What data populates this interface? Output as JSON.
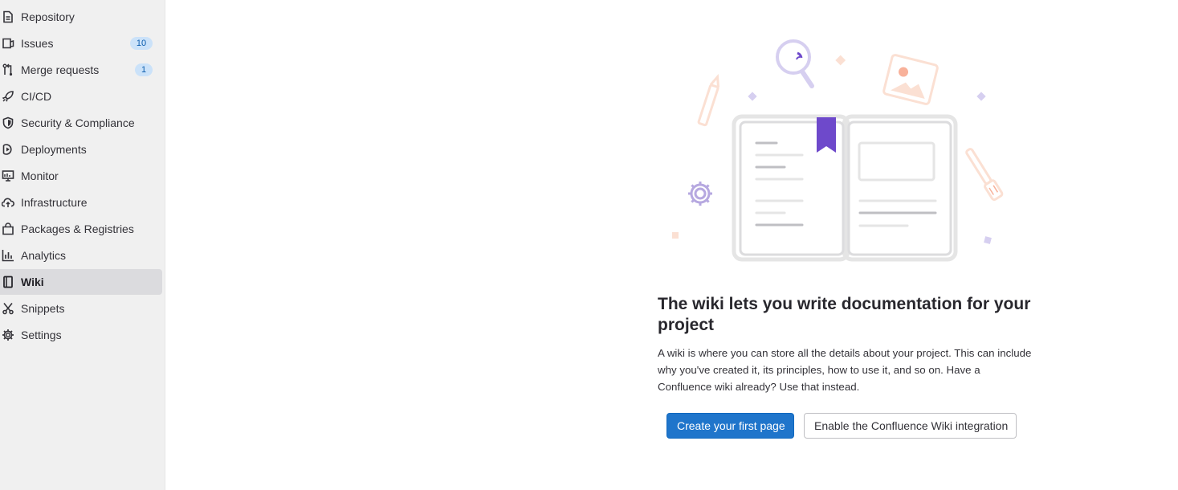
{
  "sidebar": {
    "items": [
      {
        "label": "Repository",
        "icon": "document-icon"
      },
      {
        "label": "Issues",
        "icon": "issues-icon",
        "badge": "10"
      },
      {
        "label": "Merge requests",
        "icon": "merge-request-icon",
        "badge": "1"
      },
      {
        "label": "CI/CD",
        "icon": "rocket-icon"
      },
      {
        "label": "Security & Compliance",
        "icon": "shield-icon"
      },
      {
        "label": "Deployments",
        "icon": "deployments-icon"
      },
      {
        "label": "Monitor",
        "icon": "monitor-icon"
      },
      {
        "label": "Infrastructure",
        "icon": "cloud-icon"
      },
      {
        "label": "Packages & Registries",
        "icon": "package-icon"
      },
      {
        "label": "Analytics",
        "icon": "chart-icon"
      },
      {
        "label": "Wiki",
        "icon": "book-icon",
        "active": true
      },
      {
        "label": "Snippets",
        "icon": "scissors-icon"
      },
      {
        "label": "Settings",
        "icon": "gear-icon"
      }
    ]
  },
  "empty_state": {
    "title": "The wiki lets you write documentation for your project",
    "description": "A wiki is where you can store all the details about your project. This can include why you've created it, its principles, how to use it, and so on. Have a Confluence wiki already? Use that instead.",
    "primary_button": "Create your first page",
    "secondary_button": "Enable the Confluence Wiki integration"
  },
  "colors": {
    "primary": "#1f75cb",
    "badge_bg": "#cbe2f9",
    "badge_text": "#0b5cad",
    "illustration_purple": "#6e49cb",
    "sidebar_bg": "#f0f0f0",
    "active_bg": "#dbdbde"
  }
}
